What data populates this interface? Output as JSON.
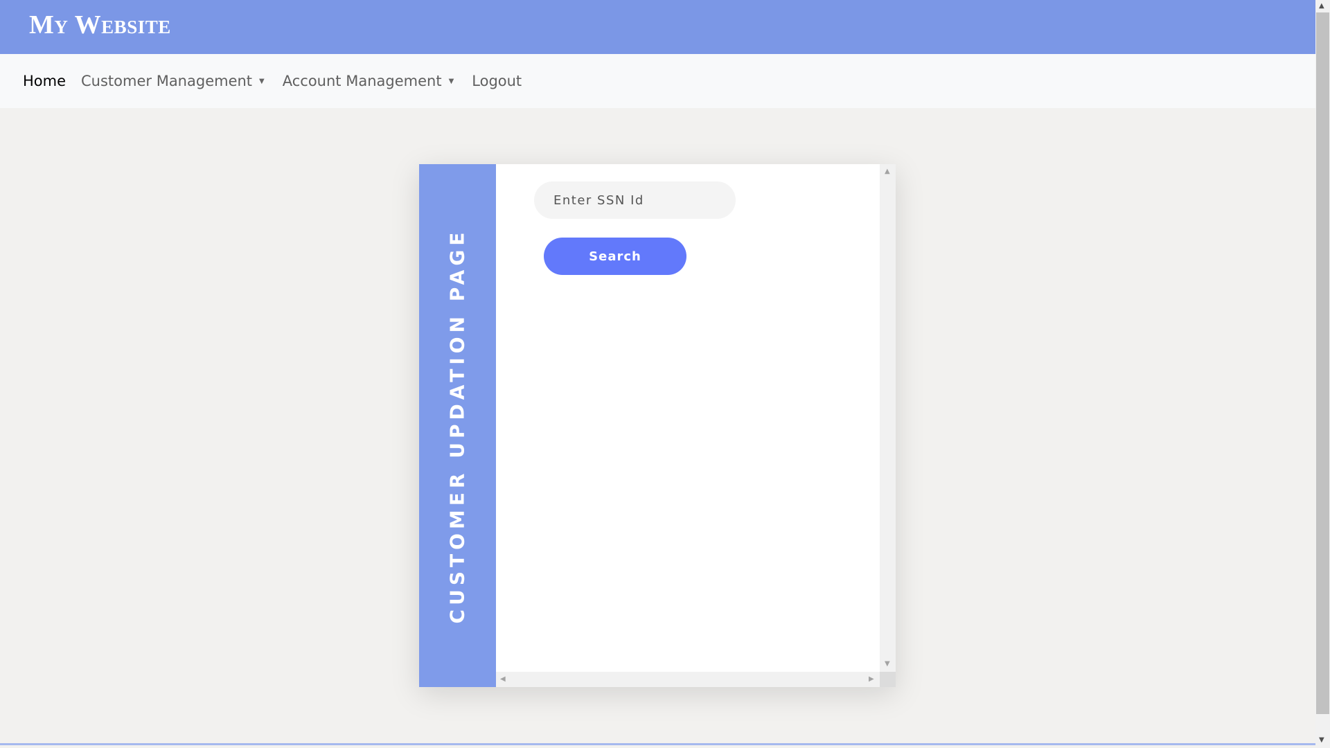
{
  "header": {
    "brand": "My Website"
  },
  "nav": {
    "items": [
      {
        "label": "Home",
        "dropdown": false
      },
      {
        "label": "Customer Management",
        "dropdown": true
      },
      {
        "label": "Account Management",
        "dropdown": true
      },
      {
        "label": "Logout",
        "dropdown": false
      }
    ],
    "caret": "▼"
  },
  "card": {
    "side_title": "CUSTOMER UPDATION PAGE",
    "ssn_placeholder": "Enter SSN Id",
    "ssn_value": "",
    "search_label": "Search"
  },
  "colors": {
    "header": "#7b97e6",
    "sidebar": "#7f9bea",
    "button": "#6279fb",
    "background": "#f2f1ef"
  },
  "icons": {
    "up": "▲",
    "down": "▼",
    "left": "◀",
    "right": "▶"
  }
}
